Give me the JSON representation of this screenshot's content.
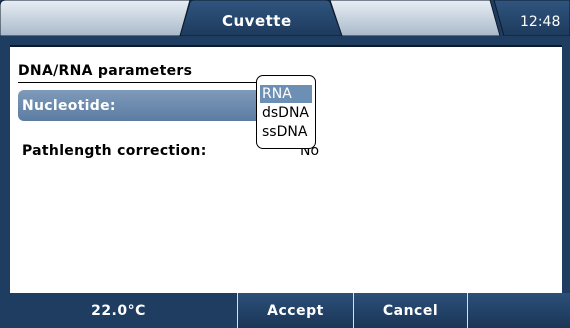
{
  "header": {
    "active_tab": "Cuvette",
    "clock": "12:48"
  },
  "panel": {
    "section_title": "DNA/RNA parameters",
    "rows": [
      {
        "label": "Nucleotide:",
        "value": ""
      },
      {
        "label": "Pathlength correction:",
        "value": "No"
      }
    ]
  },
  "dropdown": {
    "options": [
      "RNA",
      "dsDNA",
      "ssDNA"
    ],
    "selected": "RNA"
  },
  "footer": {
    "temperature": "22.0°C",
    "accept_label": "Accept",
    "cancel_label": "Cancel"
  },
  "colors": {
    "background": "#1f3d60",
    "highlight": "#6d8fb4",
    "tab_active": "#1f3d60",
    "tab_inactive": "#b9c7d6"
  }
}
